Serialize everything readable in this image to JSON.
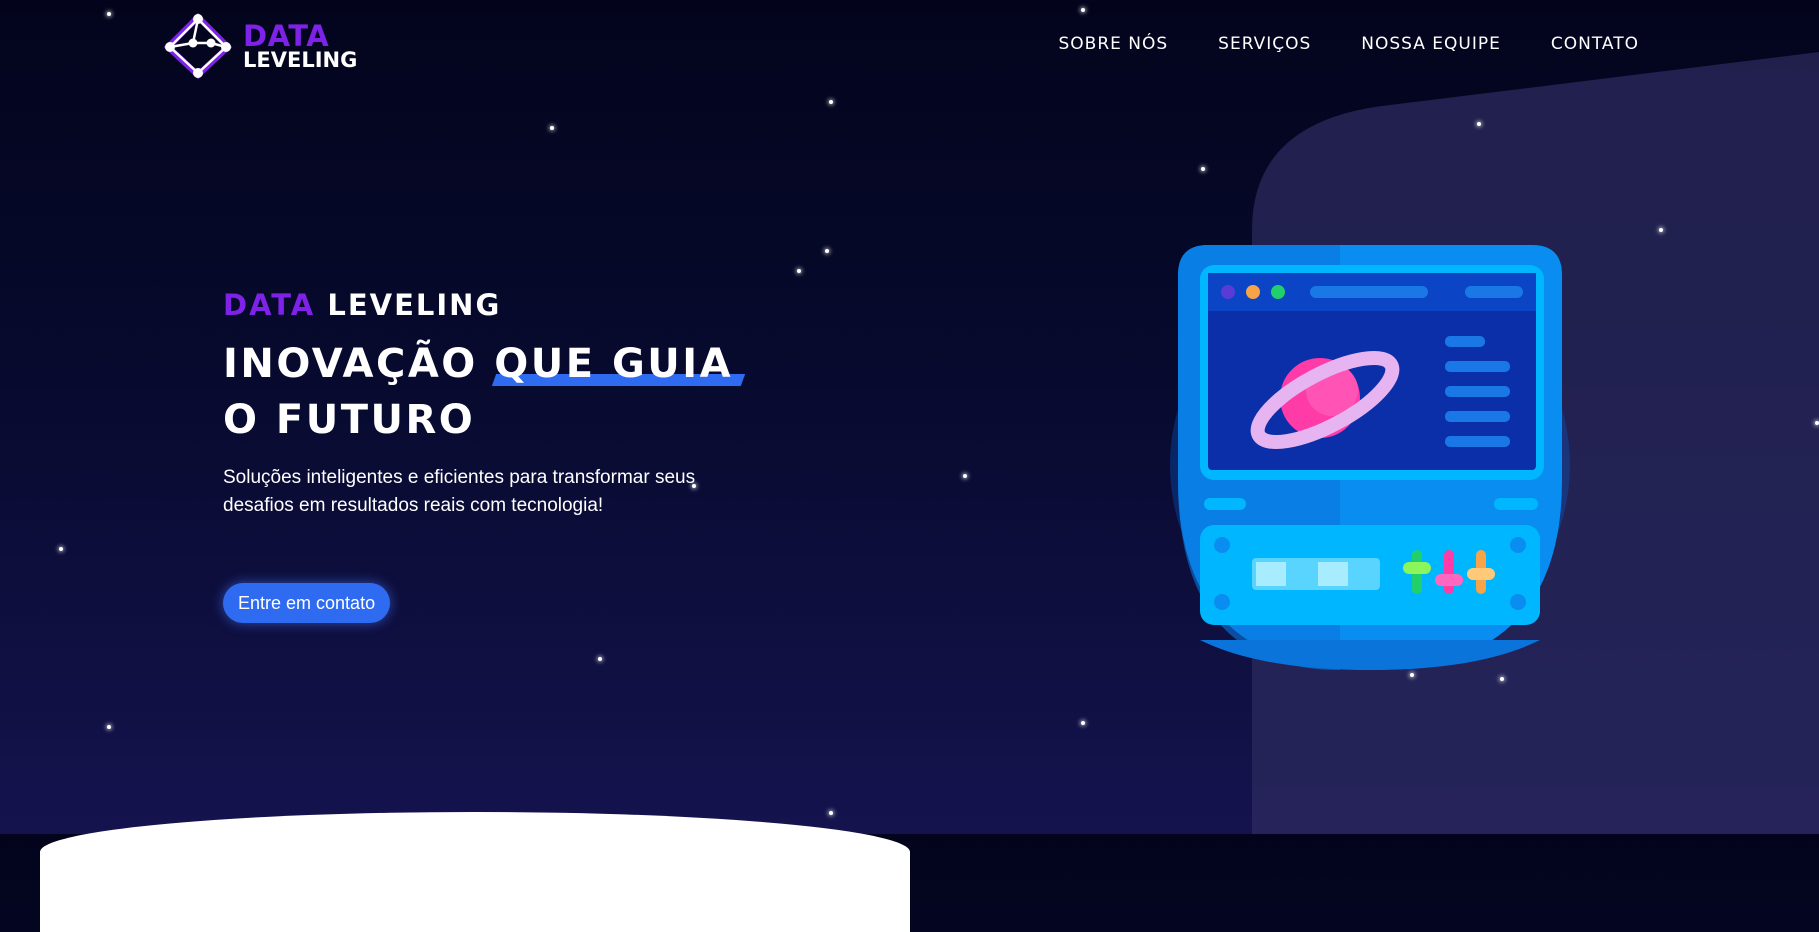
{
  "logo": {
    "line1": "DATA",
    "line2": "LEVELING"
  },
  "nav": {
    "items": [
      "SOBRE NÓS",
      "SERVIÇOS",
      "NOSSA EQUIPE",
      "CONTATO"
    ]
  },
  "hero": {
    "brand_part1": "DATA",
    "brand_part2": "LEVELING",
    "headline_before": "INOVAÇÃO ",
    "headline_highlight": "QUE GUIA",
    "headline_after": " O FUTURO",
    "subtitle": "Soluções inteligentes e eficientes para transformar seus desafios em resultados reais com tecnologia!",
    "cta_label": "Entre em contato"
  },
  "colors": {
    "accent_purple": "#7d22e6",
    "accent_blue": "#2e6bf0",
    "background_dark": "#03041c",
    "machine_blue": "#0a9bf5"
  },
  "icons": {
    "logo": "diamond-network-icon",
    "illustration": "planet-computer-illustration"
  }
}
